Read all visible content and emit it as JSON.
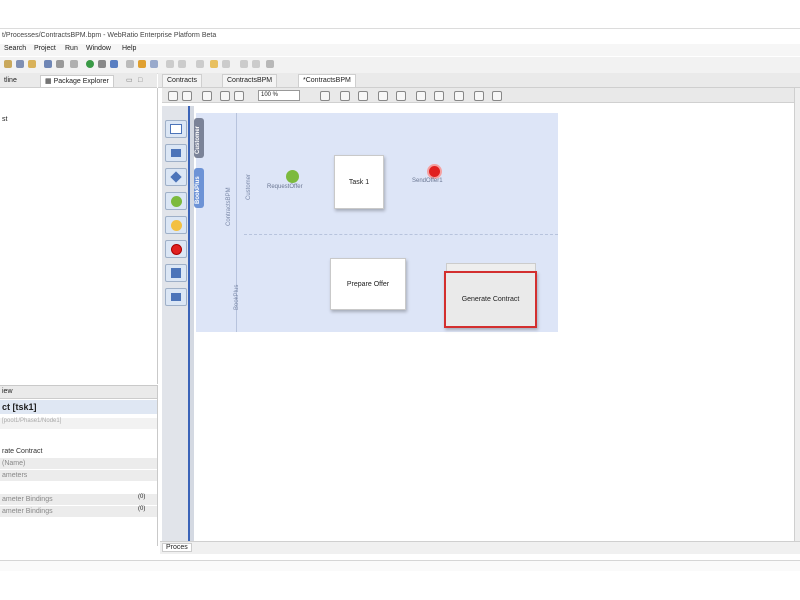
{
  "window": {
    "title": "t/Processes/ContractsBPM.bpm - WebRatio Enterprise Platform Beta"
  },
  "menu": {
    "items": [
      "Search",
      "Project",
      "Run",
      "Window",
      "Help"
    ]
  },
  "left_tabs": {
    "outline": "tline",
    "package_explorer": "Package Explorer"
  },
  "left_panel": {
    "tree_item": "st"
  },
  "editor_tabs": [
    "Contracts",
    "ContractsBPM",
    "*ContractsBPM"
  ],
  "zoom": "100 %",
  "diagram": {
    "pool_tab": "Customer",
    "lane_tab": "BookPlus",
    "lane1_label": "Customer",
    "lane2_label": "ContractsBPM",
    "lane3_label": "BookPlus",
    "start_event_label": "RequestOffer",
    "end_event_label": "SendOffer1",
    "tasks": {
      "task1": "Task 1",
      "prepare_offer": "Prepare Offer",
      "generate_contract": "Generate Contract"
    }
  },
  "properties": {
    "tab": "iew",
    "title": "ct [tsk1]",
    "path": "[pool1/Phase1/Node1]",
    "rows": [
      {
        "label": "rate Contract",
        "value": ""
      },
      {
        "label": "(Name)",
        "value": ""
      },
      {
        "label": "ameters",
        "value": ""
      },
      {
        "label": "ameter Bindings",
        "value": "(0)"
      },
      {
        "label": "ameter Bindings",
        "value": "(0)"
      }
    ]
  },
  "bottom_tab": "Proces",
  "colors": {
    "pool_bg": "#dde5f7",
    "start_event": "#7cba3e",
    "end_event": "#e02020",
    "selection": "#d32f2f",
    "lane_tab": "#6d93d6",
    "pool_tab": "#7b8398"
  }
}
